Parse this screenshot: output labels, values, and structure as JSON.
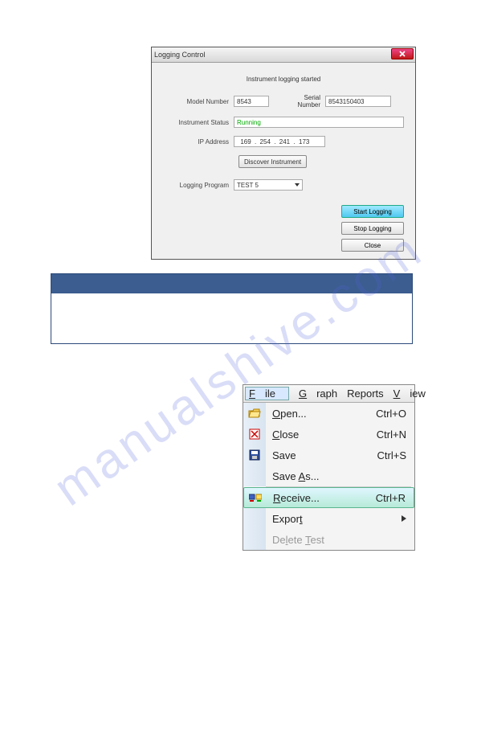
{
  "watermark": "manualshive.com",
  "dialog": {
    "title": "Logging Control",
    "heading": "Instrument logging started",
    "modelLabel": "Model Number",
    "modelValue": "8543",
    "serialLabel": "Serial Number",
    "serialValue": "8543150403",
    "statusLabel": "Instrument Status",
    "statusValue": "Running",
    "ipLabel": "IP Address",
    "ip": {
      "a": "169",
      "b": "254",
      "c": "241",
      "d": "173"
    },
    "discover": "Discover Instrument",
    "programLabel": "Logging Program",
    "programValue": "TEST 5",
    "start": "Start Logging",
    "stop": "Stop Logging",
    "close": "Close"
  },
  "menu": {
    "file": "File",
    "graph": "Graph",
    "reports": "Reports",
    "view": "View",
    "items": {
      "open": "Open...",
      "openSc": "Ctrl+O",
      "close": "Close",
      "closeSc": "Ctrl+N",
      "save": "Save",
      "saveSc": "Ctrl+S",
      "saveAs": "Save As...",
      "receive": "Receive...",
      "receiveSc": "Ctrl+R",
      "export": "Export",
      "delete": "Delete Test"
    }
  }
}
